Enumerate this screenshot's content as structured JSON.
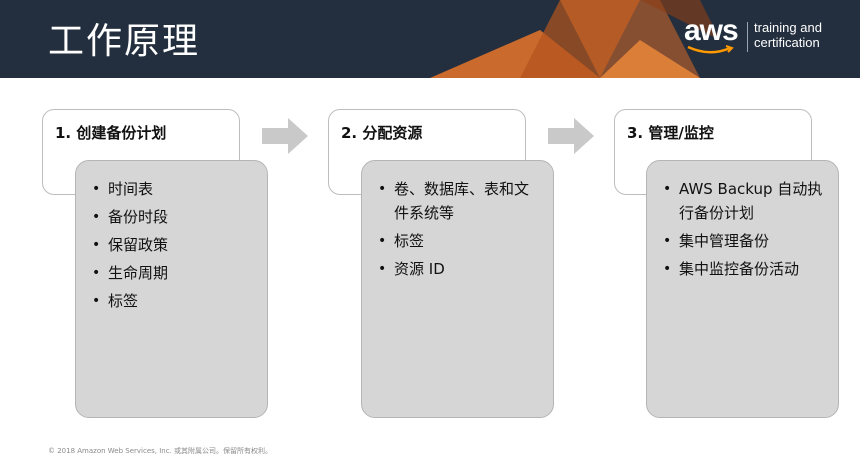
{
  "header": {
    "title": "工作原理",
    "background_color": "#232f3e",
    "accent_color": "#e8742a"
  },
  "logo": {
    "word": "aws",
    "tagline_line1": "training and",
    "tagline_line2": "certification"
  },
  "steps": [
    {
      "label": "1. 创建备份计划",
      "items": [
        "时间表",
        "备份时段",
        "保留政策",
        "生命周期",
        "标签"
      ]
    },
    {
      "label": "2. 分配资源",
      "items": [
        "卷、数据库、表和文件系统等",
        "标签",
        "资源 ID"
      ]
    },
    {
      "label": "3. 管理/监控",
      "items": [
        "AWS Backup 自动执行备份计划",
        "集中管理备份",
        "集中监控备份活动"
      ]
    }
  ],
  "footer": {
    "copyright": "© 2018 Amazon Web Services, Inc. 或其附属公司。保留所有权利。"
  },
  "icons": {
    "arrow": "right-arrow-icon",
    "smile": "aws-smile-icon"
  }
}
